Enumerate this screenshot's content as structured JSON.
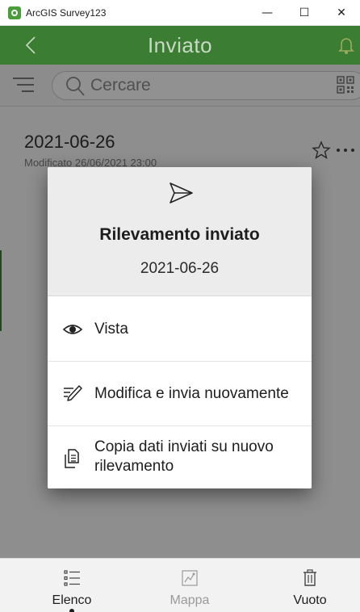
{
  "window": {
    "title": "ArcGIS Survey123",
    "minimize_glyph": "—",
    "maximize_glyph": "☐",
    "close_glyph": "✕"
  },
  "appbar": {
    "title": "Inviato",
    "back_icon": "chevron-left-icon",
    "action_icon": "bell-icon"
  },
  "search": {
    "placeholder": "Cercare",
    "filter_icon": "filter-icon",
    "qr_icon": "qr-code-icon"
  },
  "survey_item": {
    "title": "2021-06-26",
    "subtitle": "Modificato 26/06/2021 23:00",
    "favorite_icon": "star-outline-icon",
    "more_icon": "more-horizontal-icon"
  },
  "dialog": {
    "icon": "send-icon",
    "title": "Rilevamento inviato",
    "subtitle": "2021-06-26",
    "actions": [
      {
        "label": "Vista",
        "icon": "eye-icon"
      },
      {
        "label": "Modifica e invia nuovamente",
        "icon": "edit-icon"
      },
      {
        "label_line1": "Copia dati inviati su nuovo",
        "label_line2": "rilevamento",
        "icon": "copy-document-icon"
      }
    ]
  },
  "bottom_tabs": [
    {
      "label": "Elenco",
      "icon": "list-icon",
      "selected": true
    },
    {
      "label": "Mappa",
      "icon": "map-icon",
      "selected": false
    },
    {
      "label": "Vuoto",
      "icon": "trash-icon",
      "selected": false
    }
  ],
  "colors": {
    "brand_green": "#3b7d33",
    "text_primary": "#1d1d1d",
    "text_disabled": "#9a9a9a"
  }
}
